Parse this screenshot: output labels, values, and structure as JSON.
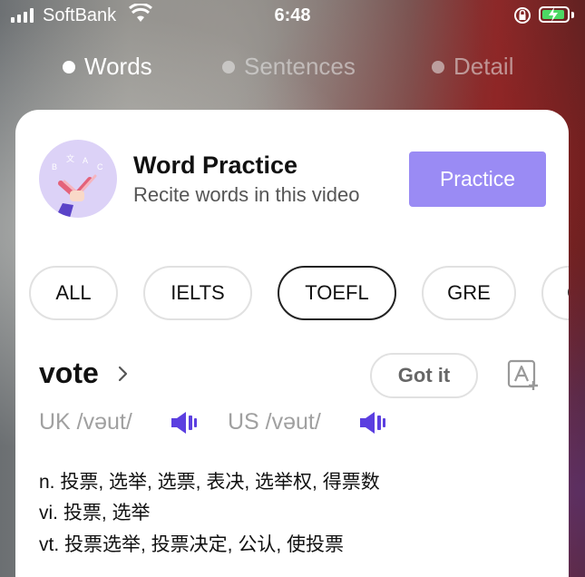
{
  "status_bar": {
    "carrier": "SoftBank",
    "time": "6:48"
  },
  "tabs": [
    {
      "label": "Words",
      "active": true
    },
    {
      "label": "Sentences",
      "active": false
    },
    {
      "label": "Detail",
      "active": false
    }
  ],
  "header": {
    "title": "Word Practice",
    "subtitle": "Recite words in this video",
    "practice_label": "Practice",
    "avatar_letters": [
      "B",
      "文",
      "A",
      "C"
    ]
  },
  "filters": [
    {
      "label": "ALL",
      "selected": false
    },
    {
      "label": "IELTS",
      "selected": false
    },
    {
      "label": "TOEFL",
      "selected": true
    },
    {
      "label": "GRE",
      "selected": false
    },
    {
      "label": "G",
      "selected": false
    }
  ],
  "word_entry": {
    "word": "vote",
    "got_it_label": "Got it",
    "uk_pron": "UK /vəut/",
    "us_pron": "US /vəut/",
    "definitions": [
      "n. 投票, 选举, 选票, 表决, 选举权, 得票数",
      "vi. 投票, 选举",
      "vt. 投票选举, 投票决定, 公认, 使投票"
    ]
  },
  "colors": {
    "accent": "#9a8bf4",
    "speaker": "#5b3fe0",
    "battery": "#4cd964"
  }
}
